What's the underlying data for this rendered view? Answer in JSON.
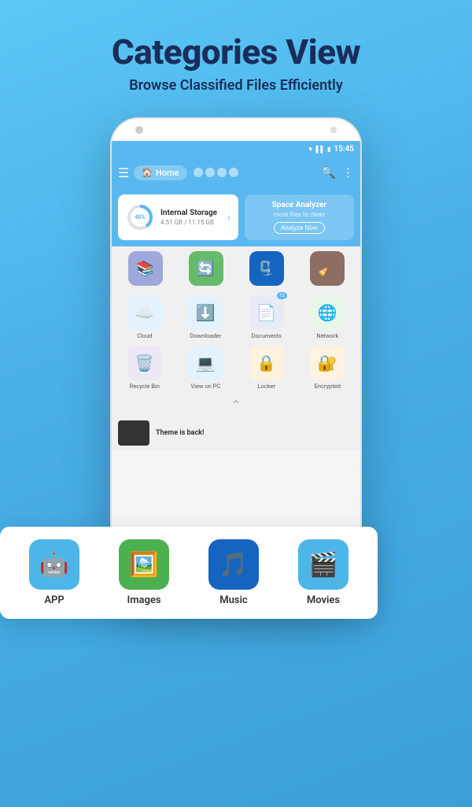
{
  "header": {
    "title": "Categories View",
    "subtitle": "Browse Classified Files Efficiently"
  },
  "status_bar": {
    "time": "15:45"
  },
  "app_bar": {
    "home_label": "Home"
  },
  "storage": {
    "percentage": "40%",
    "title": "Internal Storage",
    "used": "4.51 GB / 11.15 GB",
    "analyzer_title": "Space Analyzer",
    "analyzer_subtitle": "more files to clean",
    "analyze_button": "Analyze Now"
  },
  "floating_categories": [
    {
      "label": "APP",
      "icon": "🤖",
      "color": "#4db6e8"
    },
    {
      "label": "Images",
      "icon": "🖼️",
      "color": "#4caf50"
    },
    {
      "label": "Music",
      "icon": "🎵",
      "color": "#1565c0"
    },
    {
      "label": "Movies",
      "icon": "🎬",
      "color": "#4db6e8"
    }
  ],
  "upper_phone_categories": [
    {
      "icon": "📚",
      "color": "#7986cb",
      "label": ""
    },
    {
      "icon": "🔄",
      "color": "#4caf50",
      "label": ""
    },
    {
      "icon": "🗜️",
      "color": "#1565c0",
      "label": ""
    },
    {
      "icon": "🧹",
      "color": "#8d6e63",
      "label": ""
    }
  ],
  "lower_phone_categories_row1": [
    {
      "label": "Cloud",
      "icon": "☁️",
      "color": "#4db6e8",
      "badge": null
    },
    {
      "label": "Downloader",
      "icon": "⬇️",
      "color": "#1565c0",
      "badge": null
    },
    {
      "label": "Documents",
      "icon": "📄",
      "color": "#5c6bc0",
      "badge": "12"
    },
    {
      "label": "Network",
      "icon": "🌐",
      "color": "#4caf50",
      "badge": null
    }
  ],
  "lower_phone_categories_row2": [
    {
      "label": "Recycle Bin",
      "icon": "🗑️",
      "color": "#7986cb",
      "badge": null
    },
    {
      "label": "View on PC",
      "icon": "💻",
      "color": "#1565c0",
      "badge": null
    },
    {
      "label": "Locker",
      "icon": "🔒",
      "color": "#f57c00",
      "badge": null
    },
    {
      "label": "Encrypted",
      "icon": "🔐",
      "color": "#f57c00",
      "badge": null
    }
  ],
  "chevron": "⌃",
  "bottom_banner": {
    "text": "Theme is back!"
  }
}
